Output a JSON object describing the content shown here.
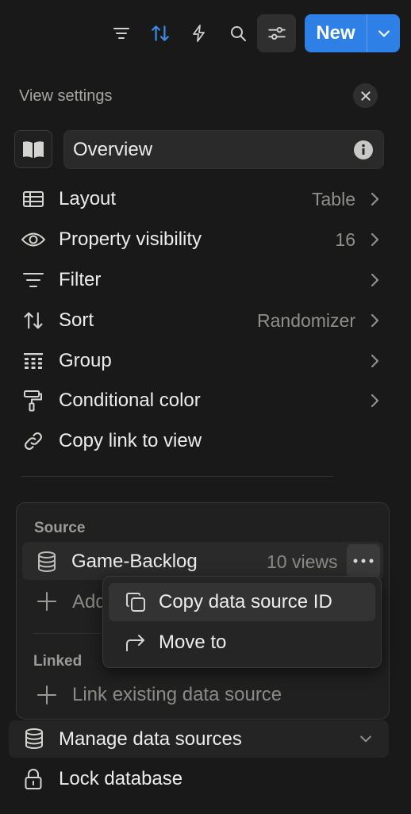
{
  "toolbar": {
    "icons": [
      "filter-lines-icon",
      "sort-arrows-icon",
      "lightning-icon",
      "search-icon",
      "sliders-icon"
    ],
    "new_label": "New",
    "accent": "#2e7fe6"
  },
  "view_settings": {
    "title": "View settings",
    "view_name": "Overview",
    "items": [
      {
        "label": "Layout",
        "value": "Table",
        "icon": "table-icon"
      },
      {
        "label": "Property visibility",
        "value": "16",
        "icon": "eye-icon"
      },
      {
        "label": "Filter",
        "value": "",
        "icon": "filter-icon"
      },
      {
        "label": "Sort",
        "value": "Randomizer",
        "icon": "sort-icon"
      },
      {
        "label": "Group",
        "value": "",
        "icon": "group-grid-icon"
      },
      {
        "label": "Conditional color",
        "value": "",
        "icon": "paint-roller-icon"
      },
      {
        "label": "Copy link to view",
        "value": "",
        "icon": "link-icon"
      }
    ]
  },
  "source_panel": {
    "source_heading": "Source",
    "source_name": "Game-Backlog",
    "source_views": "10 views",
    "add_label": "Add",
    "linked_heading": "Linked",
    "link_existing": "Link existing data source"
  },
  "context_menu": {
    "items": [
      {
        "label": "Copy data source ID",
        "icon": "copy-icon"
      },
      {
        "label": "Move to",
        "icon": "move-arrow-icon"
      }
    ]
  },
  "footer": {
    "manage_label": "Manage data sources",
    "lock_label": "Lock database"
  }
}
